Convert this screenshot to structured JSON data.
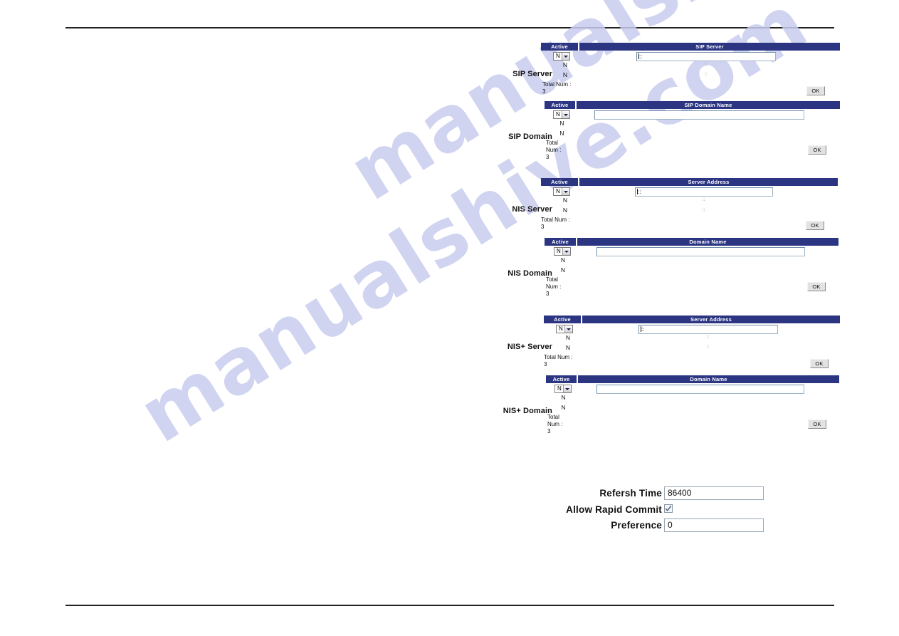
{
  "page": {
    "watermark_line1": "manualshive.com",
    "watermark_line2": "manualshive.com"
  },
  "colors": {
    "header_bar": "#2b3582",
    "header_text": "#ffffff",
    "watermark": "#c8cdee"
  },
  "sections": [
    {
      "label": "SIP Server",
      "active_header": "Active",
      "value_header": "SIP Server",
      "active_value": "N",
      "input_value": "::",
      "rows": [
        {
          "active": "N",
          "value": "::"
        },
        {
          "active": "N",
          "value": "::"
        }
      ],
      "total_label": "Total Num :",
      "total_value": "3",
      "ok_label": "OK"
    },
    {
      "label": "SIP Domain",
      "active_header": "Active",
      "value_header": "SIP Domain Name",
      "active_value": "N",
      "input_value": "",
      "rows": [
        {
          "active": "N",
          "value": ""
        },
        {
          "active": "N",
          "value": ""
        }
      ],
      "total_label": "Total Num :",
      "total_value": "3",
      "ok_label": "OK"
    },
    {
      "label": "NIS Server",
      "active_header": "Active",
      "value_header": "Server Address",
      "active_value": "N",
      "input_value": "::",
      "rows": [
        {
          "active": "N",
          "value": "::"
        },
        {
          "active": "N",
          "value": "::"
        }
      ],
      "total_label": "Total Num :",
      "total_value": "3",
      "ok_label": "OK"
    },
    {
      "label": "NIS Domain",
      "active_header": "Active",
      "value_header": "Domain Name",
      "active_value": "N",
      "input_value": "",
      "rows": [
        {
          "active": "N",
          "value": ""
        },
        {
          "active": "N",
          "value": ""
        }
      ],
      "total_label": "Total Num :",
      "total_value": "3",
      "ok_label": "OK"
    },
    {
      "label": "NIS+ Server",
      "active_header": "Active",
      "value_header": "Server Address",
      "active_value": "N",
      "input_value": "::",
      "rows": [
        {
          "active": "N",
          "value": "::"
        },
        {
          "active": "N",
          "value": "::"
        }
      ],
      "total_label": "Total Num :",
      "total_value": "3",
      "ok_label": "OK"
    },
    {
      "label": "NIS+ Domain",
      "active_header": "Active",
      "value_header": "Domain Name",
      "active_value": "N",
      "input_value": "",
      "rows": [
        {
          "active": "N",
          "value": ""
        },
        {
          "active": "N",
          "value": ""
        }
      ],
      "total_label": "Total Num :",
      "total_value": "3",
      "ok_label": "OK"
    }
  ],
  "bottom_form": {
    "clipped_total_value": "3",
    "refresh_time_label": "Refersh Time",
    "refresh_time_value": "86400",
    "rapid_commit_label": "Allow Rapid Commit",
    "rapid_commit_checked": true,
    "preference_label": "Preference",
    "preference_value": "0"
  }
}
